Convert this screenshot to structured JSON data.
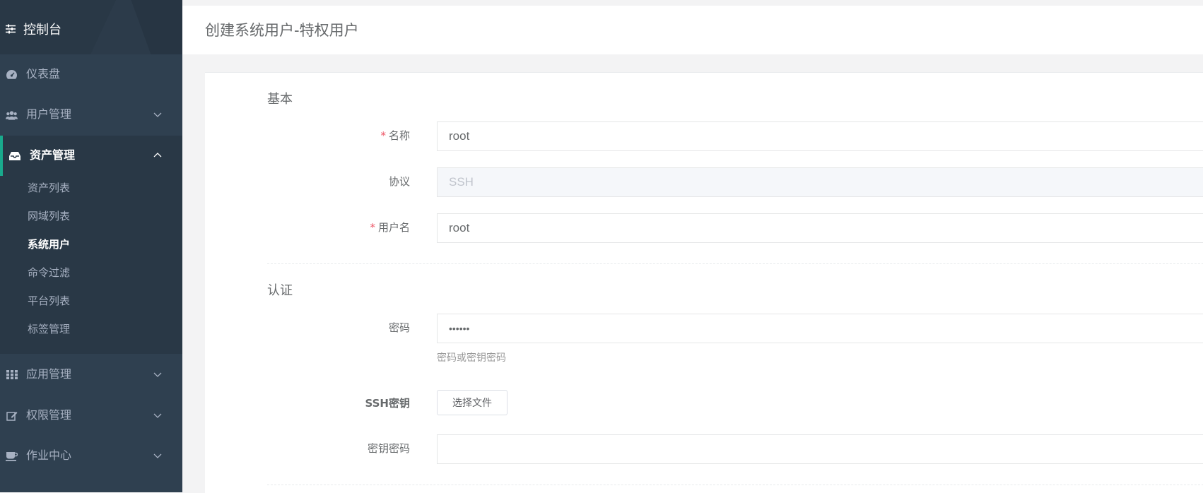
{
  "sidebar": {
    "brand": "控制台",
    "items": [
      {
        "label": "仪表盘",
        "icon": "dashboard-icon"
      },
      {
        "label": "用户管理",
        "icon": "users-icon"
      },
      {
        "label": "资产管理",
        "icon": "inbox-icon"
      },
      {
        "label": "应用管理",
        "icon": "grid-icon"
      },
      {
        "label": "权限管理",
        "icon": "edit-icon"
      },
      {
        "label": "作业中心",
        "icon": "coffee-icon"
      }
    ],
    "submenu": [
      "资产列表",
      "网域列表",
      "系统用户",
      "命令过滤",
      "平台列表",
      "标签管理"
    ]
  },
  "header": {
    "title": "创建系统用户-特权用户"
  },
  "form": {
    "section_basic": "基本",
    "name_label": "名称",
    "name_value": "root",
    "protocol_label": "协议",
    "protocol_value": "SSH",
    "username_label": "用户名",
    "username_value": "root",
    "section_auth": "认证",
    "password_label": "密码",
    "password_value": "••••••",
    "password_hint": "密码或密钥密码",
    "ssh_key_label": "SSH密钥",
    "choose_file": "选择文件",
    "key_password_label": "密钥密码",
    "required_mark": "*"
  },
  "colors": {
    "sidebar": "#2f4050",
    "accent": "#19aa8d",
    "required": "#ed5565"
  }
}
